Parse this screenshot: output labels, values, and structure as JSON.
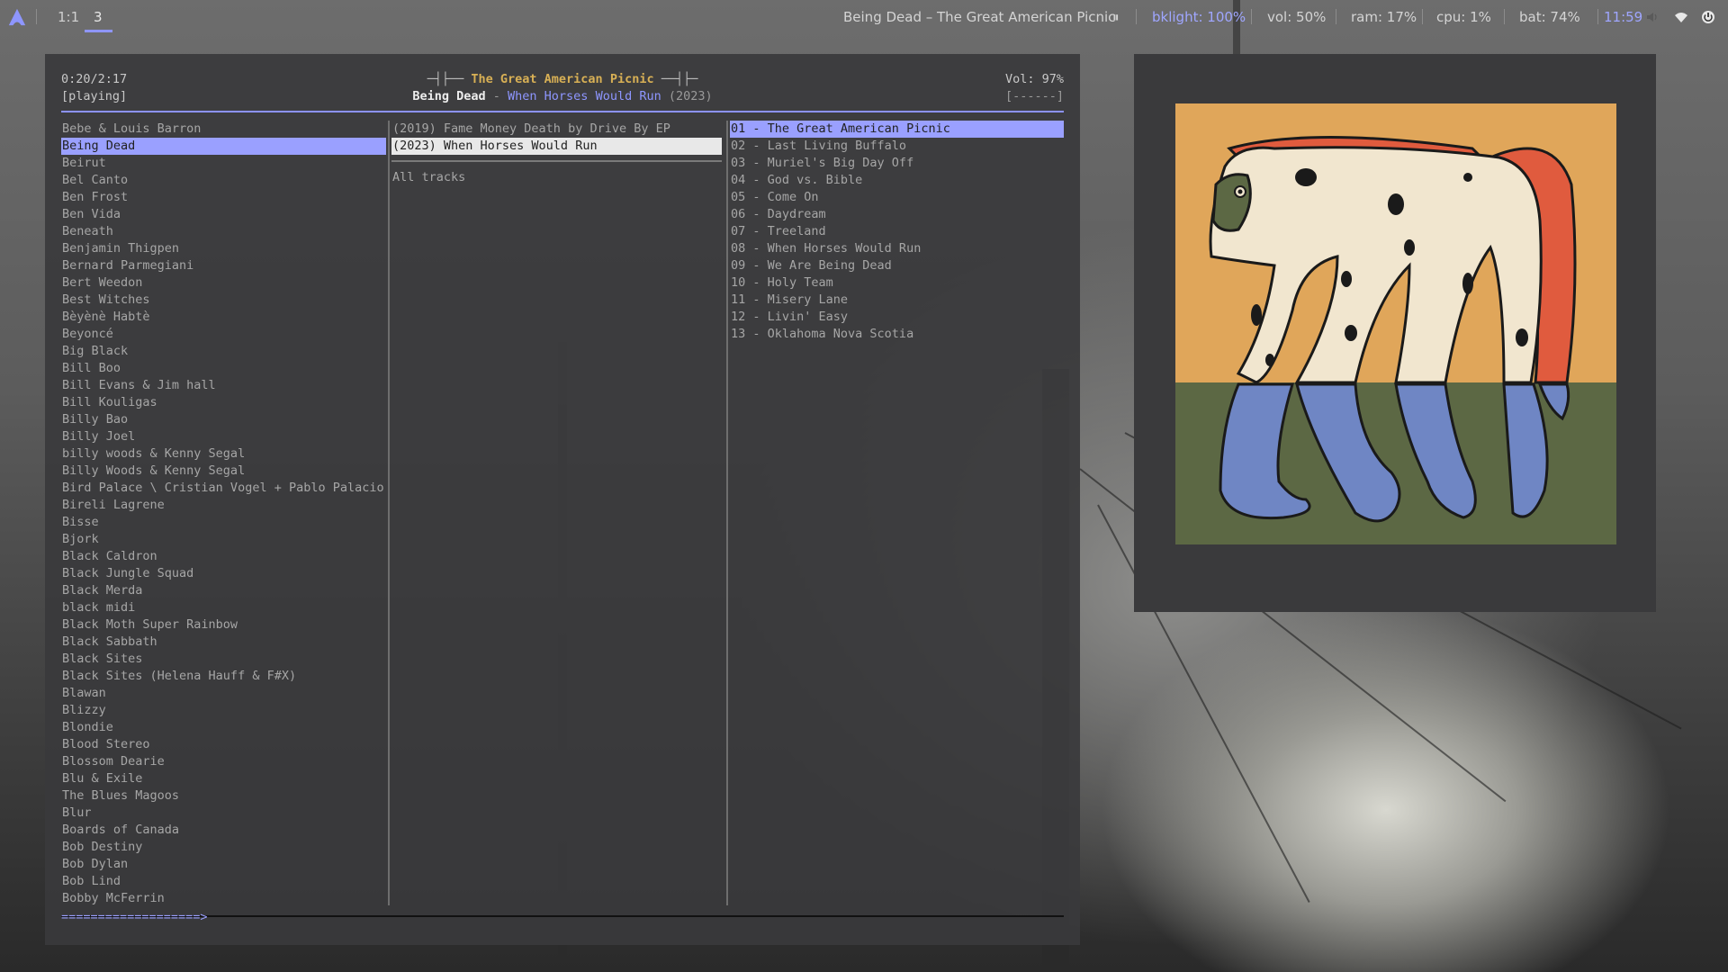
{
  "topbar": {
    "workspaces": [
      "1:1",
      "3"
    ],
    "now_playing": "Being Dead  –  The Great American Picnic",
    "pause_symbol": "⏸",
    "backlight": "bklight: 100%",
    "volume": "vol: 50%",
    "ram": "ram: 17%",
    "cpu": "cpu: 1%",
    "battery": "bat: 74%",
    "clock": "11:59",
    "accent_color": "#9fa6ff"
  },
  "player": {
    "time": "0:20/2:17",
    "status": "[playing]",
    "title": "The Great American Picnic",
    "title_left_deco": "─┤├── ",
    "title_right_deco": " ──┤├─",
    "artist": "Being Dead",
    "separator": " - ",
    "album": "When Horses Would Run",
    "year": " (2023)",
    "volume": "Vol: 97%",
    "volume_bar": "[------]",
    "progress": "===================>"
  },
  "artists": [
    "Bebe & Louis Barron",
    "Being Dead",
    "Beirut",
    "Bel Canto",
    "Ben Frost",
    "Ben Vida",
    "Beneath",
    "Benjamin Thigpen",
    "Bernard Parmegiani",
    "Bert Weedon",
    "Best Witches",
    "Bèyènè Habtè",
    "Beyoncé",
    "Big Black",
    "Bill Boo",
    "Bill Evans & Jim hall",
    "Bill Kouligas",
    "Billy Bao",
    "Billy Joel",
    "billy woods & Kenny Segal",
    "Billy Woods & Kenny Segal",
    "Bird Palace \\ Cristian Vogel + Pablo Palacio",
    "Bireli Lagrene",
    "Bisse",
    "Bjork",
    "Black Caldron",
    "Black Jungle Squad",
    "Black Merda",
    "black midi",
    "Black Moth Super Rainbow",
    "Black Sabbath",
    "Black Sites",
    "Black Sites (Helena Hauff & F#X)",
    "Blawan",
    "Blizzy",
    "Blondie",
    "Blood Stereo",
    "Blossom Dearie",
    "Blu & Exile",
    "The Blues Magoos",
    "Blur",
    "Boards of Canada",
    "Bob Destiny",
    "Bob Dylan",
    "Bob Lind",
    "Bobby McFerrin"
  ],
  "selected_artist_index": 1,
  "albums": [
    "(2019) Fame Money Death by Drive By EP",
    "(2023) When Horses Would Run"
  ],
  "selected_album_index": 1,
  "all_tracks_label": "All tracks",
  "tracks": [
    "01 - The Great American Picnic",
    "02 - Last Living Buffalo",
    "03 - Muriel's Big Day Off",
    "04 - God vs. Bible",
    "05 - Come On",
    "06 - Daydream",
    "07 - Treeland",
    "08 - When Horses Would Run",
    "09 - We Are Being Dead",
    "10 - Holy Team",
    "11 - Misery Lane",
    "12 - Livin' Easy",
    "13 - Oklahoma Nova Scotia"
  ],
  "selected_track_index": 0,
  "icons": {
    "launcher": "arch-logo-icon",
    "speaker": "speaker-icon",
    "wifi": "wifi-icon",
    "power": "power-icon",
    "album_art": "album-cover-horse-image"
  },
  "colors": {
    "selection": "#9aa0ff",
    "title": "#d8b055",
    "album": "#8e96ff"
  }
}
